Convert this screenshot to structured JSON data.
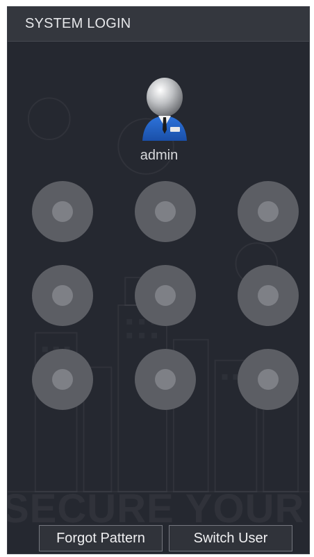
{
  "header": {
    "title": "SYSTEM LOGIN"
  },
  "user": {
    "name": "admin",
    "avatar_icon": "user-avatar-icon"
  },
  "pattern": {
    "rows": 3,
    "cols": 3,
    "dot_icon": "pattern-dot-icon"
  },
  "footer": {
    "forgot_label": "Forgot Pattern",
    "switch_label": "Switch User"
  },
  "watermark": {
    "text": "SECURE YOUR LI"
  },
  "colors": {
    "background": "#252830",
    "titlebar": "#34373e",
    "dot_outer": "#5c5e64",
    "dot_inner": "#7e8086",
    "avatar_suit": "#1f5fc4",
    "text": "#e6e7ea"
  }
}
